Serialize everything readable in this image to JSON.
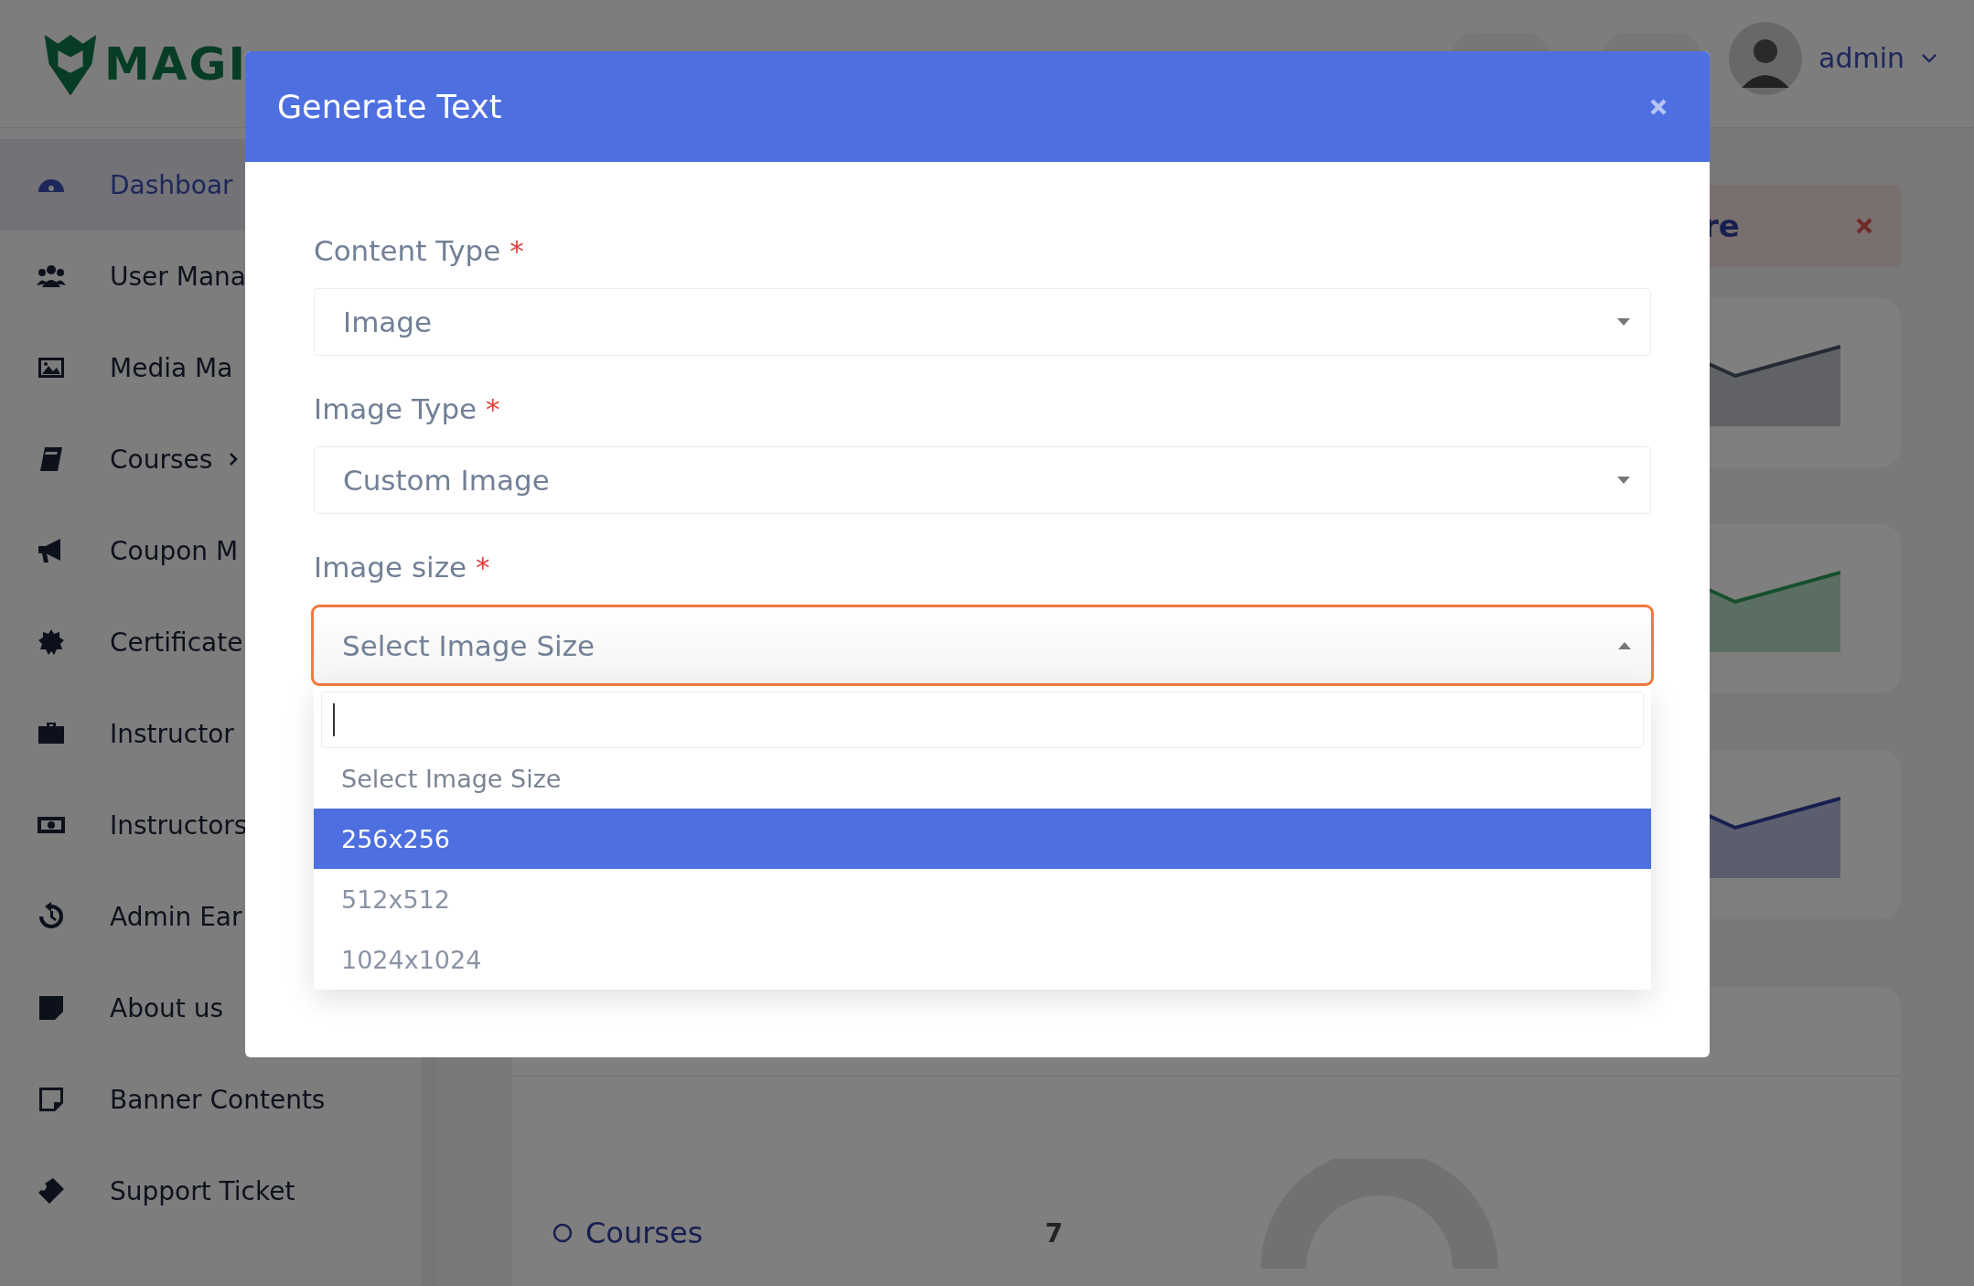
{
  "brand": {
    "logo_text": "MAGI"
  },
  "header": {
    "user": "admin"
  },
  "sidebar": {
    "items": [
      {
        "label": "Dashboar",
        "selected": true,
        "has_submenu": false
      },
      {
        "label": "User Mana",
        "selected": false,
        "has_submenu": false
      },
      {
        "label": "Media Ma",
        "selected": false,
        "has_submenu": false
      },
      {
        "label": "Courses",
        "selected": false,
        "has_submenu": true
      },
      {
        "label": "Coupon M",
        "selected": false,
        "has_submenu": false
      },
      {
        "label": "Certificate",
        "selected": false,
        "has_submenu": false
      },
      {
        "label": "Instructor",
        "selected": false,
        "has_submenu": false
      },
      {
        "label": "Instructors",
        "selected": false,
        "has_submenu": false
      },
      {
        "label": "Admin Ear",
        "selected": false,
        "has_submenu": false
      },
      {
        "label": "About us",
        "selected": false,
        "has_submenu": false
      },
      {
        "label": "Banner Contents",
        "selected": false,
        "has_submenu": false
      },
      {
        "label": "Support Ticket",
        "selected": false,
        "has_submenu": false
      }
    ]
  },
  "alert": {
    "text": "re"
  },
  "status_card": {
    "legend": [
      {
        "label": "Courses",
        "value": "7"
      }
    ]
  },
  "modal": {
    "title": "Generate Text",
    "fields": [
      {
        "label": "Content Type",
        "required_mark": "*",
        "value": "Image",
        "open": false
      },
      {
        "label": "Image Type",
        "required_mark": "*",
        "value": "Custom Image",
        "open": false
      },
      {
        "label": "Image size",
        "required_mark": "*",
        "value": "Select Image Size",
        "open": true
      }
    ],
    "dropdown": {
      "options": [
        {
          "label": "Select Image Size",
          "kind": "placeholder",
          "selected": false
        },
        {
          "label": "256x256",
          "kind": "option",
          "selected": true
        },
        {
          "label": "512x512",
          "kind": "option",
          "selected": false
        },
        {
          "label": "1024x1024",
          "kind": "option",
          "selected": false
        }
      ]
    }
  }
}
